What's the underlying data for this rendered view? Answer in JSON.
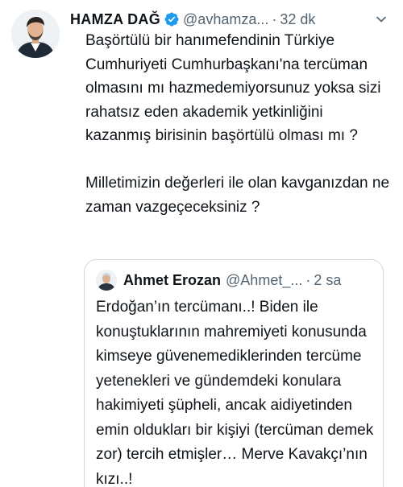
{
  "tweet": {
    "author_name": "HAMZA DAĞ",
    "handle": "@avhamza...",
    "separator": "·",
    "time": "32 dk",
    "paragraphs": [
      "Başörtülü bir hanımefendinin Türkiye Cumhuriyeti Cumhurbaşkanı'na tercüman olmasını mı hazmedemiyorsunuz yoksa sizi rahatsız eden akademik yetkinliğini kazanmış birisinin başörtülü olması mı ?",
      "Milletimizin değerleri ile olan kavganızdan ne zaman vazgeçeceksiniz ?"
    ],
    "more_icon": "chevron-down-icon",
    "verified_icon": "verified-badge-icon",
    "colors": {
      "verified": "#1d9bf0",
      "secondary_text": "#536471",
      "border": "#cfd9de"
    }
  },
  "quoted_tweet": {
    "author_name": "Ahmet Erozan",
    "handle": "@Ahmet_...",
    "separator": "·",
    "time": "2 sa",
    "text": "Erdoğan’ın tercümanı..! Biden ile konuştuklarının mahremiyeti konusunda kimseye güvenemediklerinden tercüme yetenekleri ve gündemdeki konulara hakimiyeti şüpheli, ancak aidiyetinden emin oldukları bir kişiyi (tercüman demek zor) tercih etmişler… Merve Kavakçı’nın kızı..!"
  }
}
